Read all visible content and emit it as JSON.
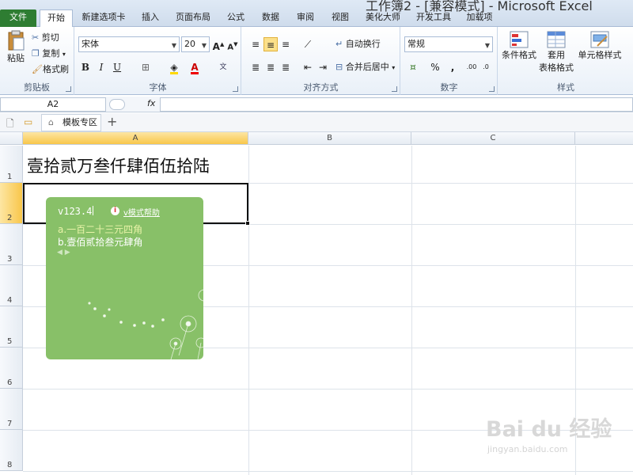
{
  "window": {
    "title": "工作簿2 - [兼容模式] - Microsoft Excel"
  },
  "tabs": [
    {
      "label": "文件"
    },
    {
      "label": "开始"
    },
    {
      "label": "新建选项卡"
    },
    {
      "label": "插入"
    },
    {
      "label": "页面布局"
    },
    {
      "label": "公式"
    },
    {
      "label": "数据"
    },
    {
      "label": "审阅"
    },
    {
      "label": "视图"
    },
    {
      "label": "美化大师"
    },
    {
      "label": "开发工具"
    },
    {
      "label": "加载项"
    }
  ],
  "ribbon": {
    "clipboard": {
      "label": "剪贴板",
      "paste": "粘贴",
      "cut": "剪切",
      "copy": "复制",
      "format_painter": "格式刷"
    },
    "font": {
      "label": "字体",
      "font_name": "宋体",
      "font_size": "20"
    },
    "alignment": {
      "label": "对齐方式",
      "wrap": "自动换行",
      "merge": "合并后居中"
    },
    "number": {
      "label": "数字",
      "format": "常规"
    },
    "styles": {
      "label": "样式",
      "conditional": "条件格式",
      "table_format_1": "套用",
      "table_format_2": "表格格式",
      "cell_styles": "单元格样式"
    }
  },
  "formula_bar": {
    "name_box": "A2",
    "fx": "fx"
  },
  "quick_tabs": {
    "template": "模板专区"
  },
  "grid": {
    "columns": [
      "A",
      "B",
      "C"
    ],
    "rows": [
      "1",
      "2",
      "3",
      "4",
      "5",
      "6",
      "7",
      "8"
    ],
    "cell_a1": "壹拾贰万叁仟肆佰伍拾陆"
  },
  "ime": {
    "input": "v123.4",
    "help": "v模式帮助",
    "candidates": [
      "a.一百二十三元四角",
      "b.壹佰贰拾叁元肆角"
    ]
  },
  "watermark": {
    "brand": "Bai du 经验",
    "url": "jingyan.baidu.com"
  },
  "colors": {
    "file_tab": "#2e7d32",
    "ime_bg": "#88c068",
    "selection": "#f8c64a"
  }
}
